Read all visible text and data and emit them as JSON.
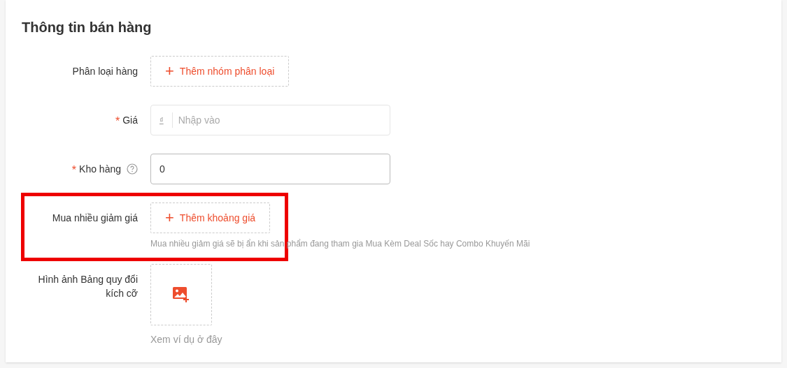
{
  "section": {
    "title": "Thông tin bán hàng"
  },
  "rows": [
    {
      "kind": "add-button",
      "label": "Phân loại hàng",
      "help": false,
      "highlighted": false,
      "button": {
        "icon": "+",
        "text": "Thêm nhóm phân loại"
      }
    },
    {
      "kind": "price-input",
      "label": "Giá",
      "required_mark": "*",
      "help": false,
      "highlighted": false,
      "currency": "₫",
      "placeholder": "Nhập vào"
    },
    {
      "kind": "number-input",
      "label": "Kho hàng",
      "required_mark": "*",
      "help": true,
      "highlighted": false,
      "value": "0"
    },
    {
      "kind": "add-button",
      "label": "Mua nhiều giảm giá",
      "help": false,
      "highlighted": true,
      "button": {
        "icon": "+",
        "text": "Thêm khoảng giá"
      },
      "hint": "Mua nhiều giảm giá sẽ bị ẩn khi sản phẩm đang tham gia Mua Kèm Deal Sốc hay Combo Khuyến Mãi"
    },
    {
      "kind": "image-upload",
      "label": "Hình ảnh Bảng quy đổi kích cỡ",
      "help": false,
      "highlighted": false,
      "link": "Xem ví dụ ở đây"
    }
  ]
}
